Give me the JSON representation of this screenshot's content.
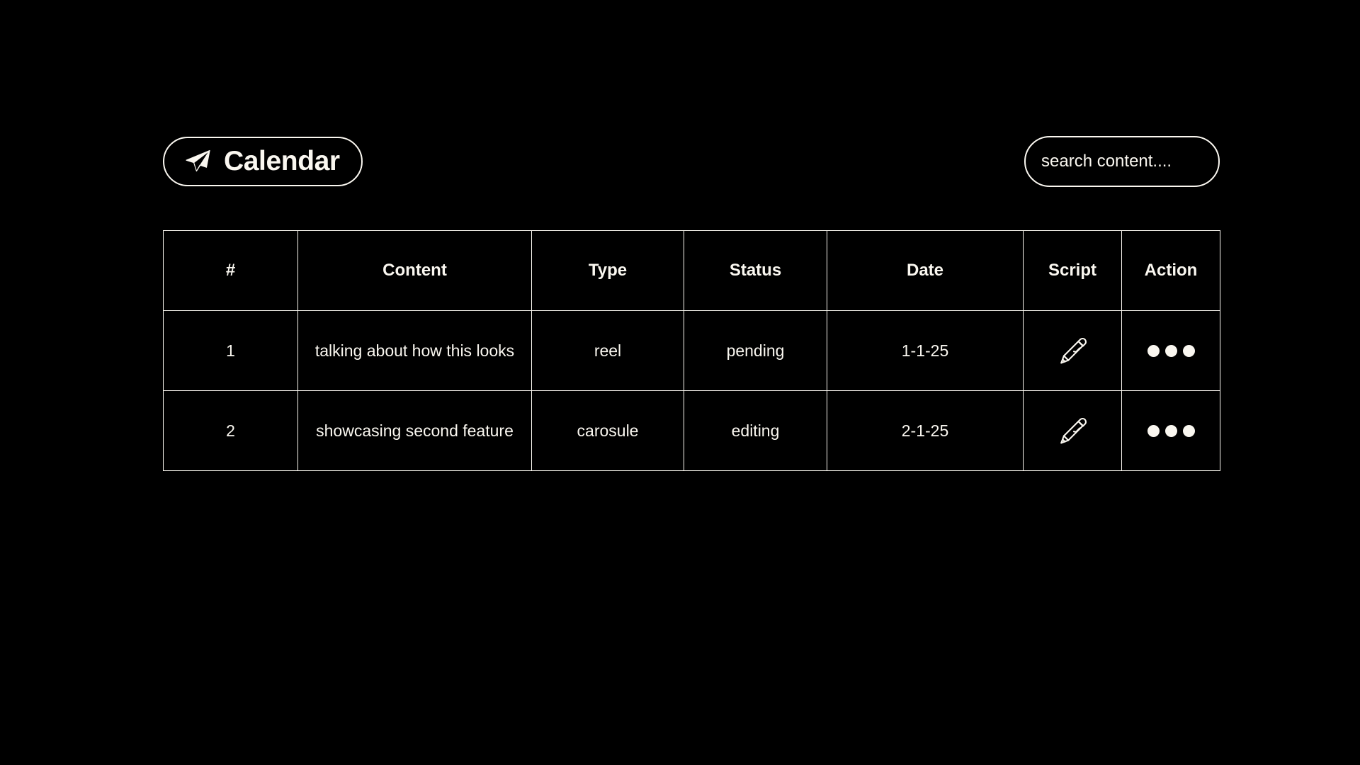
{
  "theme": {
    "background": "#000000",
    "foreground": "#FAF7F0",
    "border": "#FAF7F0"
  },
  "header": {
    "logo": {
      "icon": "paper-plane-icon",
      "label": "Calendar"
    },
    "search": {
      "value": "",
      "placeholder": "search content...."
    }
  },
  "table": {
    "columns": [
      {
        "key": "num",
        "label": "#"
      },
      {
        "key": "content",
        "label": "Content"
      },
      {
        "key": "type",
        "label": "Type"
      },
      {
        "key": "status",
        "label": "Status"
      },
      {
        "key": "date",
        "label": "Date"
      },
      {
        "key": "script",
        "label": "Script"
      },
      {
        "key": "action",
        "label": "Action"
      }
    ],
    "rows": [
      {
        "num": "1",
        "content": "talking about how this looks",
        "type": "reel",
        "status": "pending",
        "date": "1-1-25",
        "script_icon": "pen-icon",
        "action_icon": "three-dots-icon"
      },
      {
        "num": "2",
        "content": "showcasing second feature",
        "type": "carosule",
        "status": "editing",
        "date": "2-1-25",
        "script_icon": "pen-icon",
        "action_icon": "three-dots-icon"
      }
    ]
  }
}
